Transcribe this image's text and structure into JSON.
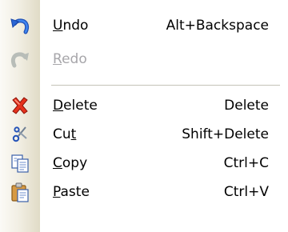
{
  "menu": {
    "items": [
      {
        "name": "undo",
        "label": "Undo",
        "mnemonic_index": 0,
        "shortcut": "Alt+Backspace",
        "enabled": true,
        "icon": "undo-arrow-icon"
      },
      {
        "name": "redo",
        "label": "Redo",
        "mnemonic_index": 0,
        "shortcut": "",
        "enabled": false,
        "icon": "redo-arrow-icon"
      },
      {
        "name": "delete",
        "label": "Delete",
        "mnemonic_index": 0,
        "shortcut": "Delete",
        "enabled": true,
        "icon": "red-x-icon"
      },
      {
        "name": "cut",
        "label": "Cut",
        "mnemonic_index": 2,
        "shortcut": "Shift+Delete",
        "enabled": true,
        "icon": "scissors-icon"
      },
      {
        "name": "copy",
        "label": "Copy",
        "mnemonic_index": 0,
        "shortcut": "Ctrl+C",
        "enabled": true,
        "icon": "copy-pages-icon"
      },
      {
        "name": "paste",
        "label": "Paste",
        "mnemonic_index": 0,
        "shortcut": "Ctrl+V",
        "enabled": true,
        "icon": "clipboard-icon"
      }
    ]
  },
  "colors": {
    "text": "#000000",
    "disabled_text": "#a7a6aa",
    "gutter": "#ece9d8",
    "separator": "#c5c2b8"
  }
}
